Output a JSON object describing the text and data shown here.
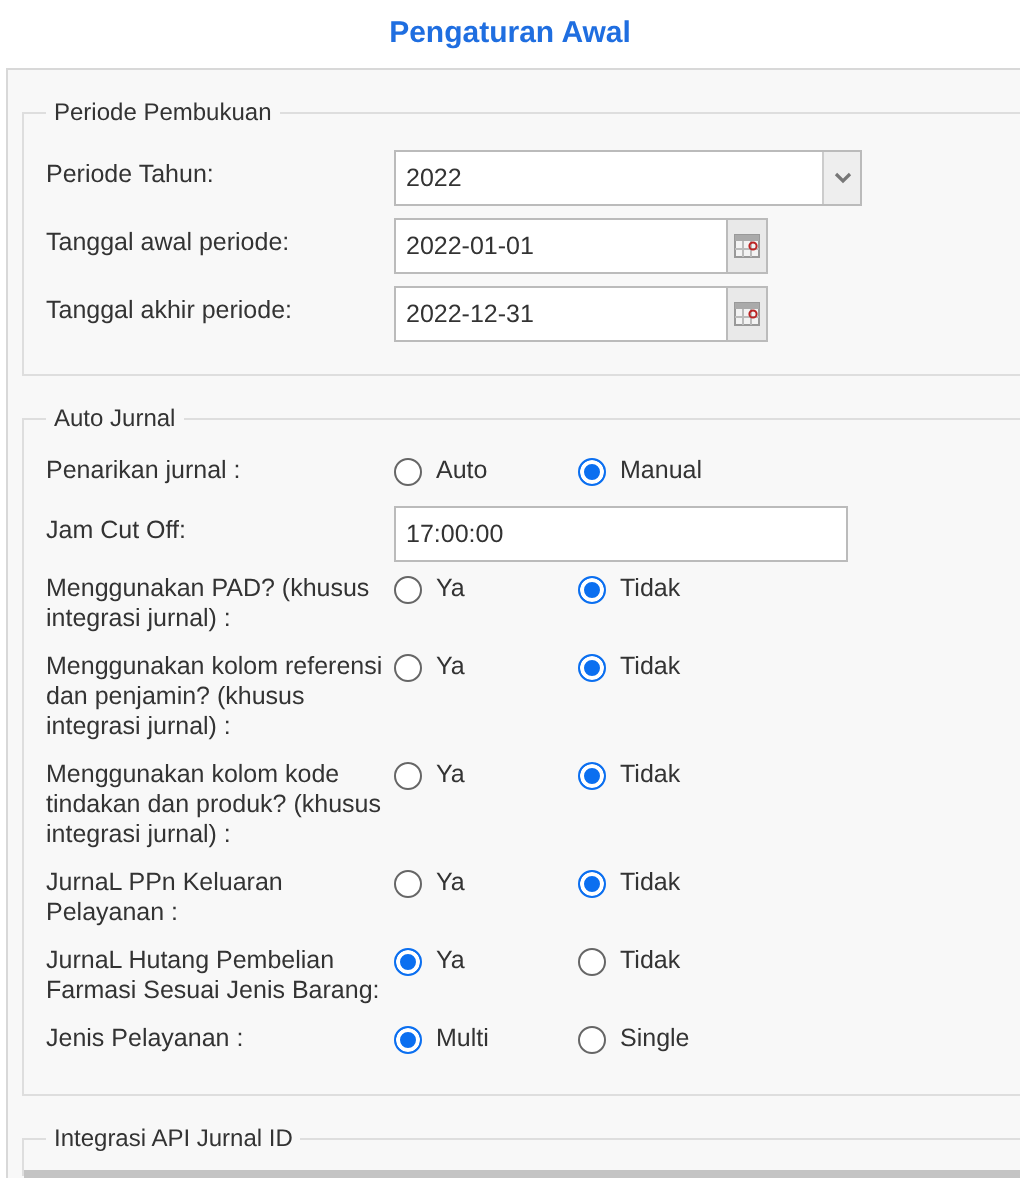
{
  "title": "Pengaturan Awal",
  "sections": [
    {
      "legend": "Periode Pembukuan",
      "fields": [
        {
          "kind": "select",
          "label": "Periode Tahun:",
          "value": "2022"
        },
        {
          "kind": "date",
          "label": "Tanggal awal periode:",
          "value": "2022-01-01"
        },
        {
          "kind": "date",
          "label": "Tanggal akhir periode:",
          "value": "2022-12-31"
        }
      ]
    },
    {
      "legend": "Auto Jurnal",
      "fields": [
        {
          "kind": "radio",
          "label": "Penarikan jurnal :",
          "options": [
            {
              "label": "Auto",
              "selected": false
            },
            {
              "label": "Manual",
              "selected": true
            }
          ]
        },
        {
          "kind": "text",
          "label": "Jam Cut Off:",
          "value": "17:00:00"
        },
        {
          "kind": "radio",
          "label": "Menggunakan PAD? (khusus integrasi jurnal) :",
          "options": [
            {
              "label": "Ya",
              "selected": false
            },
            {
              "label": "Tidak",
              "selected": true
            }
          ]
        },
        {
          "kind": "radio",
          "label": "Menggunakan kolom referensi dan penjamin? (khusus integrasi jurnal) :",
          "options": [
            {
              "label": "Ya",
              "selected": false
            },
            {
              "label": "Tidak",
              "selected": true
            }
          ]
        },
        {
          "kind": "radio",
          "label": "Menggunakan kolom kode tindakan dan produk? (khusus integrasi jurnal) :",
          "options": [
            {
              "label": "Ya",
              "selected": false
            },
            {
              "label": "Tidak",
              "selected": true
            }
          ]
        },
        {
          "kind": "radio",
          "label": "JurnaL PPn Keluaran Pelayanan :",
          "options": [
            {
              "label": "Ya",
              "selected": false
            },
            {
              "label": "Tidak",
              "selected": true
            }
          ]
        },
        {
          "kind": "radio",
          "label": "JurnaL Hutang Pembelian Farmasi Sesuai Jenis Barang:",
          "options": [
            {
              "label": "Ya",
              "selected": true
            },
            {
              "label": "Tidak",
              "selected": false
            }
          ]
        },
        {
          "kind": "radio",
          "label": "Jenis Pelayanan :",
          "options": [
            {
              "label": "Multi",
              "selected": true
            },
            {
              "label": "Single",
              "selected": false
            }
          ]
        }
      ]
    },
    {
      "legend": "Integrasi API Jurnal ID"
    }
  ]
}
